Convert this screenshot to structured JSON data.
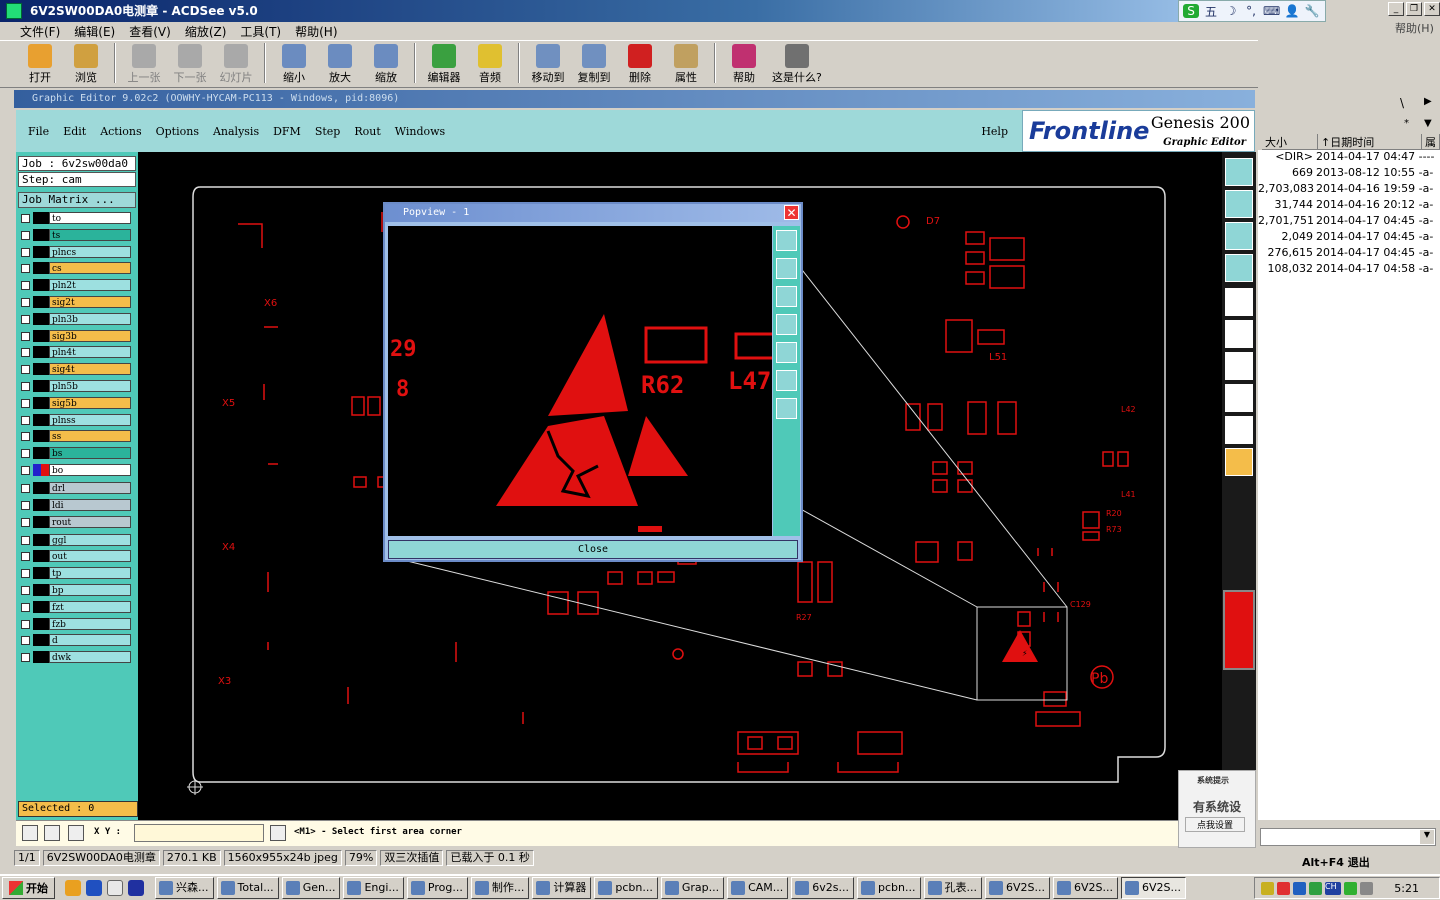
{
  "acdsee": {
    "title": "6V2SW00DA0电测章 - ACDSee v5.0",
    "help_menu": "帮助(H)",
    "menu": [
      "文件(F)",
      "编辑(E)",
      "查看(V)",
      "缩放(Z)",
      "工具(T)",
      "帮助(H)"
    ],
    "toolbar": [
      {
        "label": "打开",
        "color": "#e8a030"
      },
      {
        "label": "浏览",
        "color": "#d0a040"
      },
      {
        "label": "上一张",
        "color": "#a0a0a0"
      },
      {
        "label": "下一张",
        "color": "#a0a0a0"
      },
      {
        "label": "幻灯片",
        "color": "#a0a0a0"
      },
      {
        "label": "缩小",
        "color": "#6b8cc0"
      },
      {
        "label": "放大",
        "color": "#6b8cc0"
      },
      {
        "label": "缩放",
        "color": "#6b8cc0"
      },
      {
        "label": "编辑器",
        "color": "#3aa040"
      },
      {
        "label": "音频",
        "color": "#e0c030"
      },
      {
        "label": "移动到",
        "color": "#7090c0"
      },
      {
        "label": "复制到",
        "color": "#7090c0"
      },
      {
        "label": "删除",
        "color": "#d02020"
      },
      {
        "label": "属性",
        "color": "#c0a060"
      },
      {
        "label": "帮助",
        "color": "#c03070"
      },
      {
        "label": "这是什么?",
        "color": "#707070"
      }
    ],
    "status": [
      "1/1",
      "6V2SW00DA0电测章",
      "270.1 KB",
      "1560x955x24b jpeg",
      "79%",
      "双三次插值",
      "已载入于 0.1 秒"
    ]
  },
  "ime": {
    "items": [
      "S",
      "五",
      "☽",
      "°,",
      "⌨",
      "👤",
      "🔧"
    ]
  },
  "genesis": {
    "title": "Graphic Editor 9.02c2 (OOWHY-HYCAM-PC113 - Windows, pid:8096)",
    "menu": [
      "File",
      "Edit",
      "Actions",
      "Options",
      "Analysis",
      "DFM",
      "Step",
      "Rout",
      "Windows"
    ],
    "help": "Help",
    "logo": {
      "brand": "Frontline",
      "product": "Genesis 200",
      "sub": "Graphic Editor"
    },
    "job": "Job : 6v2sw00da0",
    "step": "Step: cam",
    "job_matrix": "Job Matrix ...",
    "layers": [
      {
        "name": "to",
        "color": "#ffffff"
      },
      {
        "name": "ts",
        "color": "#2bb39b"
      },
      {
        "name": "plncs",
        "color": "#9de0e0"
      },
      {
        "name": "cs",
        "color": "#f4bd4a"
      },
      {
        "name": "pln2t",
        "color": "#9de0e0"
      },
      {
        "name": "sig2t",
        "color": "#f4bd4a"
      },
      {
        "name": "pln3b",
        "color": "#9de0e0"
      },
      {
        "name": "sig3b",
        "color": "#f4bd4a"
      },
      {
        "name": "pln4t",
        "color": "#9de0e0"
      },
      {
        "name": "sig4t",
        "color": "#f4bd4a"
      },
      {
        "name": "pln5b",
        "color": "#9de0e0"
      },
      {
        "name": "sig5b",
        "color": "#f4bd4a"
      },
      {
        "name": "plnss",
        "color": "#9de0e0"
      },
      {
        "name": "ss",
        "color": "#f4bd4a"
      },
      {
        "name": "bs",
        "color": "#2bb39b"
      },
      {
        "name": "bo",
        "color": "#ffffff"
      },
      {
        "name": "drl",
        "color": "#b8c8d0"
      },
      {
        "name": "ldi",
        "color": "#b8c8d0"
      },
      {
        "name": "rout",
        "color": "#b8c8d0"
      },
      {
        "name": "ggl",
        "color": "#9de0e0"
      },
      {
        "name": "out",
        "color": "#9de0e0"
      },
      {
        "name": "tp",
        "color": "#9de0e0"
      },
      {
        "name": "bp",
        "color": "#9de0e0"
      },
      {
        "name": "fzt",
        "color": "#9de0e0"
      },
      {
        "name": "fzb",
        "color": "#9de0e0"
      },
      {
        "name": "d",
        "color": "#9de0e0"
      },
      {
        "name": "dwk",
        "color": "#9de0e0"
      }
    ],
    "selected": "Selected : 0",
    "xy_label": "X Y :",
    "status_msg": "<M1> - Select first area corner",
    "canvas_labels": [
      "X6",
      "X5",
      "X4",
      "X3",
      "D7",
      "L51",
      "R20",
      "R73",
      "L41",
      "L42",
      "R62",
      "L47",
      "R27",
      "C129"
    ]
  },
  "popview": {
    "title": "Popview - 1",
    "close": "Close",
    "labels": [
      "R62",
      "L47",
      "29",
      "8"
    ]
  },
  "explorer": {
    "headers": [
      "大小",
      "↑日期时间",
      "属"
    ],
    "rows": [
      {
        "size": "<DIR>",
        "date": "2014-04-17 04:47 ----"
      },
      {
        "size": "669",
        "date": "2013-08-12 10:55 -a-"
      },
      {
        "size": "2,703,083",
        "date": "2014-04-16 19:59 -a-"
      },
      {
        "size": "31,744",
        "date": "2014-04-16 20:12 -a-"
      },
      {
        "size": "2,701,751",
        "date": "2014-04-17 04:45 -a-"
      },
      {
        "size": "2,049",
        "date": "2014-04-17 04:45 -a-"
      },
      {
        "size": "276,615",
        "date": "2014-04-17 04:45 -a-"
      },
      {
        "size": "108,032",
        "date": "2014-04-17 04:58 -a-"
      }
    ],
    "altf4": "Alt+F4 退出"
  },
  "notify": {
    "title": "系统提示",
    "msg": "有系统设",
    "btn": "点我设置"
  },
  "taskbar": {
    "start": "开始",
    "tasks": [
      "兴森...",
      "Total...",
      "Gen...",
      "Engi...",
      "Prog...",
      "制作...",
      "计算器",
      "pcbn...",
      "Grap...",
      "CAM...",
      "6v2s...",
      "pcbn...",
      "孔表...",
      "6V2S...",
      "6V2S...",
      "6V2S..."
    ],
    "clock": "5:21"
  },
  "colors": {
    "accent": "#4fc9b8",
    "pcb": "#e01010"
  }
}
